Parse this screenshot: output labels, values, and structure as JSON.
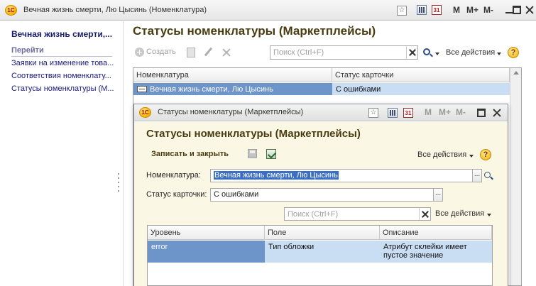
{
  "window": {
    "title": "Вечная жизнь смерти, Лю Цысинь (Номенклатура)",
    "logo": "1С",
    "calendar_label": "31",
    "memory_buttons": [
      "M",
      "M+",
      "M-"
    ]
  },
  "left_panel": {
    "title": "Вечная жизнь смерти,...",
    "section": "Перейти",
    "links": [
      "Заявки на изменение това...",
      "Соответствия номенклату...",
      "Статусы номенклатуры (М..."
    ]
  },
  "main": {
    "title": "Статусы номенклатуры (Маркетплейсы)",
    "create_label": "Создать",
    "search_placeholder": "Поиск (Ctrl+F)",
    "all_actions_label": "Все действия",
    "help_label": "?",
    "table": {
      "columns": [
        "Номенклатура",
        "Статус карточки"
      ],
      "rows": [
        {
          "item": "Вечная жизнь смерти, Лю Цысинь",
          "status": "С ошибками"
        }
      ]
    }
  },
  "modal": {
    "window_title": "Статусы номенклатуры (Маркетплейсы)",
    "title": "Статусы номенклатуры (Маркетплейсы)",
    "save_close_label": "Записать и закрыть",
    "all_actions_label": "Все действия",
    "help_label": "?",
    "fields": {
      "item_label": "Номенклатура:",
      "item_value": "Вечная жизнь смерти, Лю Цысинь",
      "status_label": "Статус карточки:",
      "status_value": "С ошибками",
      "dots": "..."
    },
    "search_placeholder": "Поиск (Ctrl+F)",
    "table": {
      "columns": [
        "Уровень",
        "Поле",
        "Описание"
      ],
      "rows": [
        {
          "level": "error",
          "field": "Тип обложки",
          "description_line1": "Атрибут склейки имеет",
          "description_line2": "пустое значение"
        }
      ]
    }
  },
  "colors": {
    "title_text": "#4a3c10",
    "selection": "#6d95c9",
    "row_highlight": "#c9ddf3",
    "modal_body": "#fbf7e5"
  }
}
